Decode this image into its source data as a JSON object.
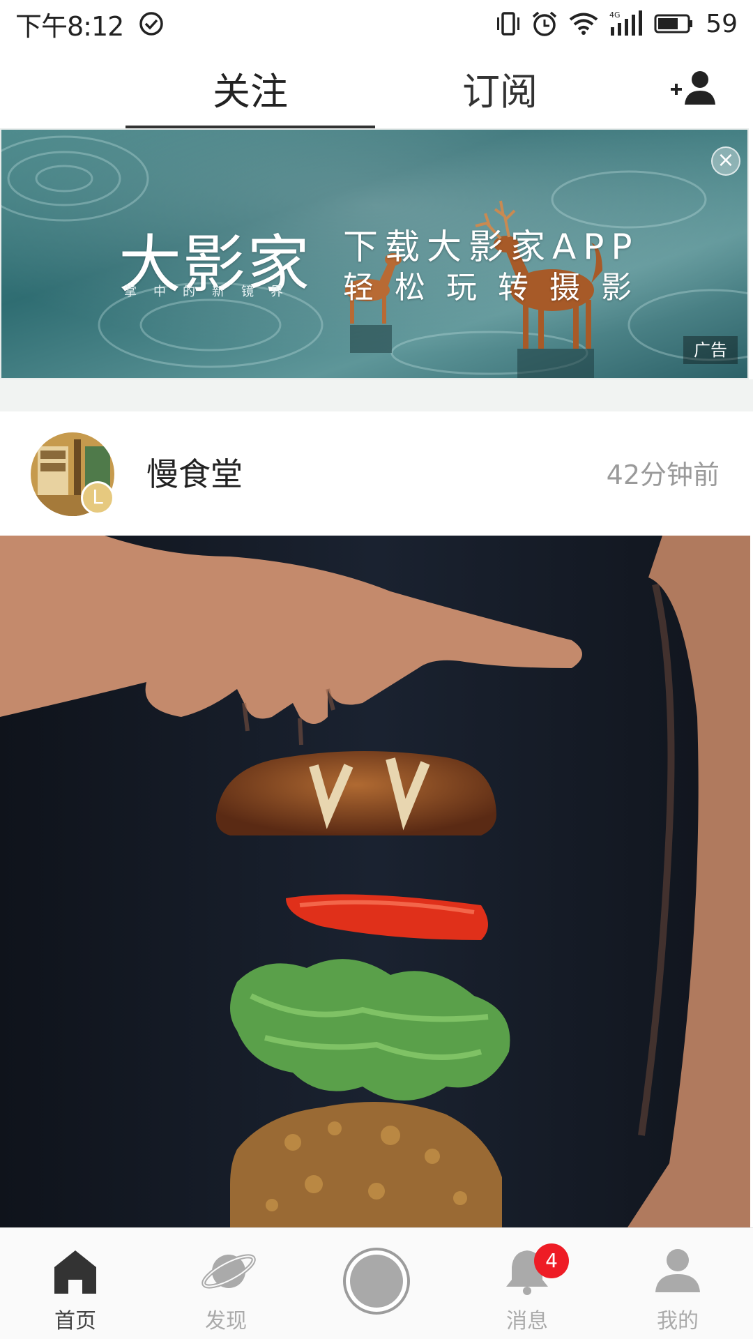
{
  "status_bar": {
    "time": "下午8:12",
    "network": "4G",
    "battery": "59",
    "icons": [
      "check-circle-icon",
      "vibrate-icon",
      "alarm-icon",
      "wifi-icon",
      "signal-icon",
      "battery-icon"
    ]
  },
  "top_tabs": {
    "tabs": [
      {
        "label": "关注",
        "active": true
      },
      {
        "label": "订阅",
        "active": false
      }
    ],
    "add_friend_icon": "add-user-icon"
  },
  "ad": {
    "brand": "大影家",
    "brand_sub": "掌中的新镜界",
    "headline": "下载大影家APP",
    "subline": "轻松玩转摄影",
    "tag": "广告",
    "close": "×"
  },
  "post": {
    "author": "慢食堂",
    "time_ago": "42分钟前",
    "avatar_badge": "L"
  },
  "bottom_nav": {
    "items": [
      {
        "label": "首页",
        "icon": "home-icon",
        "active": true
      },
      {
        "label": "发现",
        "icon": "planet-icon",
        "active": false
      },
      {
        "label": "",
        "icon": "publish-icon",
        "active": false
      },
      {
        "label": "消息",
        "icon": "bell-icon",
        "active": false,
        "badge": "4"
      },
      {
        "label": "我的",
        "icon": "user-icon",
        "active": false
      }
    ]
  },
  "colors": {
    "accent_badge": "#ee1c25",
    "tab_text": "#333333",
    "muted": "#9a9a9a"
  }
}
